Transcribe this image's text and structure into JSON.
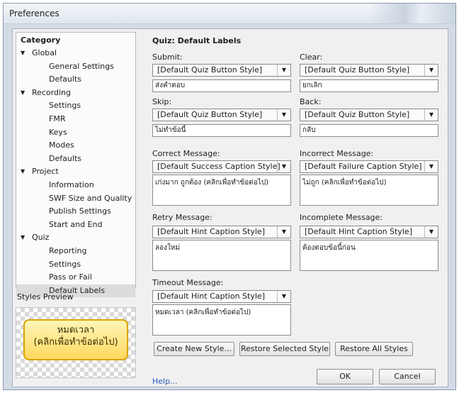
{
  "window": {
    "title": "Preferences"
  },
  "category": {
    "header": "Category",
    "items": [
      {
        "label": "Global",
        "level": 0
      },
      {
        "label": "General Settings",
        "level": 1
      },
      {
        "label": "Defaults",
        "level": 1
      },
      {
        "label": "Recording",
        "level": 0
      },
      {
        "label": "Settings",
        "level": 1
      },
      {
        "label": "FMR",
        "level": 1
      },
      {
        "label": "Keys",
        "level": 1
      },
      {
        "label": "Modes",
        "level": 1
      },
      {
        "label": "Defaults",
        "level": 1
      },
      {
        "label": "Project",
        "level": 0
      },
      {
        "label": "Information",
        "level": 1
      },
      {
        "label": "SWF Size and Quality",
        "level": 1
      },
      {
        "label": "Publish Settings",
        "level": 1
      },
      {
        "label": "Start and End",
        "level": 1
      },
      {
        "label": "Quiz",
        "level": 0
      },
      {
        "label": "Reporting",
        "level": 1
      },
      {
        "label": "Settings",
        "level": 1
      },
      {
        "label": "Pass or Fail",
        "level": 1
      },
      {
        "label": "Default Labels",
        "level": 1,
        "selected": true
      }
    ]
  },
  "preview": {
    "label": "Styles Preview",
    "caption_line1": "หมดเวลา",
    "caption_line2": "(คลิกเพื่อทำข้อต่อไป)"
  },
  "main": {
    "title": "Quiz: Default Labels",
    "submit": {
      "label": "Submit:",
      "style": "[Default Quiz Button Style]",
      "value": "ส่งคำตอบ"
    },
    "clear": {
      "label": "Clear:",
      "style": "[Default Quiz Button Style]",
      "value": "ยกเลิก"
    },
    "skip": {
      "label": "Skip:",
      "style": "[Default Quiz Button Style]",
      "value": "ไม่ทำข้อนี้"
    },
    "back": {
      "label": "Back:",
      "style": "[Default Quiz Button Style]",
      "value": "กลับ"
    },
    "correct": {
      "label": "Correct Message:",
      "style": "[Default Success Caption Style]",
      "value": "เก่งมาก ถูกต้อง (คลิกเพื่อทำข้อต่อไป)"
    },
    "incorrect": {
      "label": "Incorrect Message:",
      "style": "[Default Failure Caption Style]",
      "value": "ไม่ถูก (คลิกเพื่อทำข้อต่อไป)"
    },
    "retry": {
      "label": "Retry Message:",
      "style": "[Default Hint Caption Style]",
      "value": "ลองใหม่"
    },
    "incomplete": {
      "label": "Incomplete Message:",
      "style": "[Default Hint Caption Style]",
      "value": "ต้องตอบข้อนี้ก่อน"
    },
    "timeout": {
      "label": "Timeout Message:",
      "style": "[Default Hint Caption Style]",
      "value": "หมดเวลา (คลิกเพื่อทำข้อต่อไป)"
    }
  },
  "buttons": {
    "create": "Create New Style...",
    "restore_selected": "Restore Selected Style",
    "restore_all": "Restore All Styles",
    "help": "Help...",
    "ok": "OK",
    "cancel": "Cancel"
  },
  "icons": {
    "tree_expanded": "triangle-down-icon",
    "dropdown": "chevron-down-icon"
  }
}
